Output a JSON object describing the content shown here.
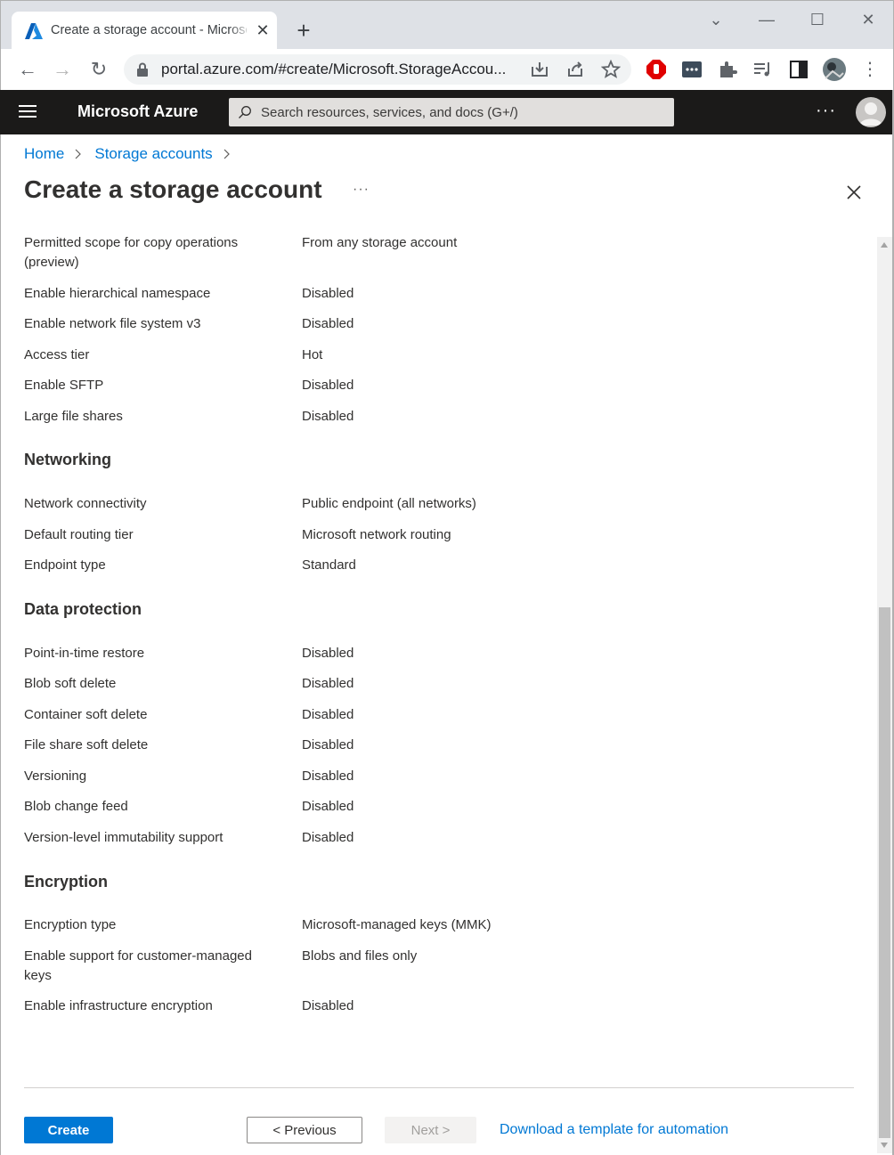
{
  "browser": {
    "tab_title": "Create a storage account - Microsoft Azure",
    "url": "portal.azure.com/#create/Microsoft.StorageAccou..."
  },
  "azure_header": {
    "brand": "Microsoft Azure",
    "search_placeholder": "Search resources, services, and docs (G+/)",
    "more": "···"
  },
  "breadcrumb": {
    "items": [
      "Home",
      "Storage accounts"
    ]
  },
  "page": {
    "title": "Create a storage account",
    "more": "···"
  },
  "advanced_rows": [
    {
      "label": "Permitted scope for copy operations (preview)",
      "value": "From any storage account"
    },
    {
      "label": "Enable hierarchical namespace",
      "value": "Disabled"
    },
    {
      "label": "Enable network file system v3",
      "value": "Disabled"
    },
    {
      "label": "Access tier",
      "value": "Hot"
    },
    {
      "label": "Enable SFTP",
      "value": "Disabled"
    },
    {
      "label": "Large file shares",
      "value": "Disabled"
    }
  ],
  "networking": {
    "heading": "Networking",
    "rows": [
      {
        "label": "Network connectivity",
        "value": "Public endpoint (all networks)"
      },
      {
        "label": "Default routing tier",
        "value": "Microsoft network routing"
      },
      {
        "label": "Endpoint type",
        "value": "Standard"
      }
    ]
  },
  "data_protection": {
    "heading": "Data protection",
    "rows": [
      {
        "label": "Point-in-time restore",
        "value": "Disabled"
      },
      {
        "label": "Blob soft delete",
        "value": "Disabled"
      },
      {
        "label": "Container soft delete",
        "value": "Disabled"
      },
      {
        "label": "File share soft delete",
        "value": "Disabled"
      },
      {
        "label": "Versioning",
        "value": "Disabled"
      },
      {
        "label": "Blob change feed",
        "value": "Disabled"
      },
      {
        "label": "Version-level immutability support",
        "value": "Disabled"
      }
    ]
  },
  "encryption": {
    "heading": "Encryption",
    "rows": [
      {
        "label": "Encryption type",
        "value": "Microsoft-managed keys (MMK)"
      },
      {
        "label": "Enable support for customer-managed keys",
        "value": "Blobs and files only"
      },
      {
        "label": "Enable infrastructure encryption",
        "value": "Disabled"
      }
    ]
  },
  "footer": {
    "create": "Create",
    "previous": "< Previous",
    "next": "Next >",
    "download": "Download a template for automation"
  },
  "colors": {
    "azure_blue": "#0078d4",
    "header_bg": "#1b1a19"
  }
}
